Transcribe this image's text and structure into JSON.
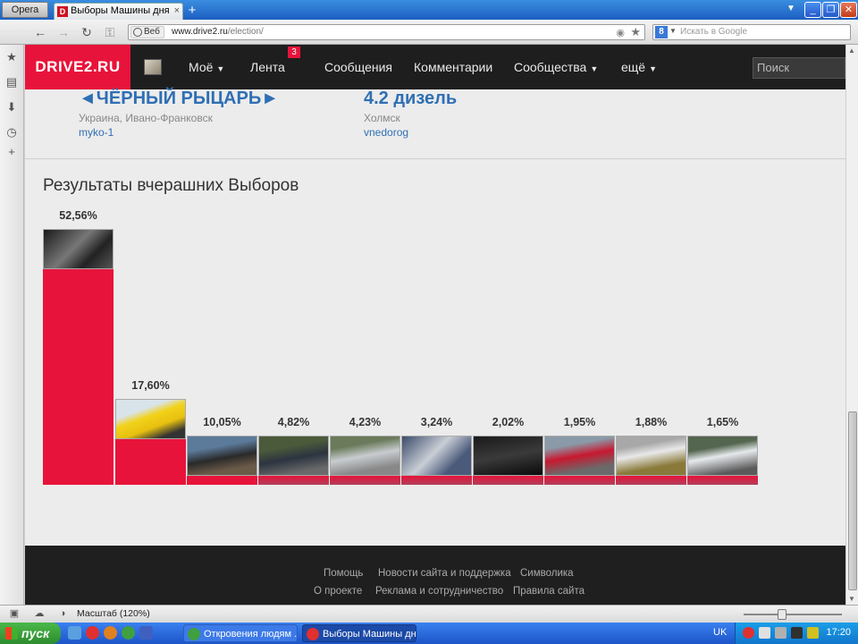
{
  "browser": {
    "menu_label": "Opera",
    "tab_title": "Выборы Машины дня",
    "tab_close": "×",
    "new_tab": "+",
    "url_badge": "Веб",
    "url_domain": "www.drive2.ru",
    "url_path": "/election/",
    "search_placeholder": "Искать в Google",
    "zoom_text": "Масштаб (120%)"
  },
  "site": {
    "logo": "DRIVE2.RU",
    "nav": [
      {
        "label": "Моё",
        "caret": true
      },
      {
        "label": "Лента",
        "caret": false
      },
      {
        "label": "Сообщения",
        "caret": false
      },
      {
        "label": "Комментарии",
        "caret": false
      },
      {
        "label": "Сообщества",
        "caret": true
      },
      {
        "label": "ещё",
        "caret": true
      }
    ],
    "feed_badge": "3",
    "search_placeholder": "Поиск"
  },
  "winners": [
    {
      "title": "◄ЧЁРНЫЙ РЫЦАРЬ►",
      "location": "Украина, Ивано-Франковск",
      "user": "myko-1"
    },
    {
      "title": "4.2 дизель",
      "location": "Холмск",
      "user": "vnedorog"
    }
  ],
  "results_title": "Результаты вчерашних Выборов",
  "chart_data": {
    "type": "bar",
    "categories": [
      "1",
      "2",
      "3",
      "4",
      "5",
      "6",
      "7",
      "8",
      "9",
      "10"
    ],
    "values": [
      52.56,
      17.6,
      10.05,
      4.82,
      4.23,
      3.24,
      2.02,
      1.95,
      1.88,
      1.65
    ],
    "labels": [
      "52,56%",
      "17,60%",
      "10,05%",
      "4,82%",
      "4,23%",
      "3,24%",
      "2,02%",
      "1,95%",
      "1,88%",
      "1,65%"
    ],
    "title": "Результаты вчерашних Выборов",
    "bar_color": "#e8133a"
  },
  "footer": {
    "row1": [
      "Помощь",
      "Новости сайта и поддержка",
      "Символика"
    ],
    "row2": [
      "О проекте",
      "Реклама и сотрудничество",
      "Правила сайта"
    ]
  },
  "taskbar": {
    "start": "пуск",
    "tasks": [
      "Откровения людям ...",
      "Выборы Машины дн..."
    ],
    "lang": "UK",
    "clock": "17:20"
  },
  "colors": {
    "accent": "#e8133a",
    "link": "#2f6fb4"
  }
}
